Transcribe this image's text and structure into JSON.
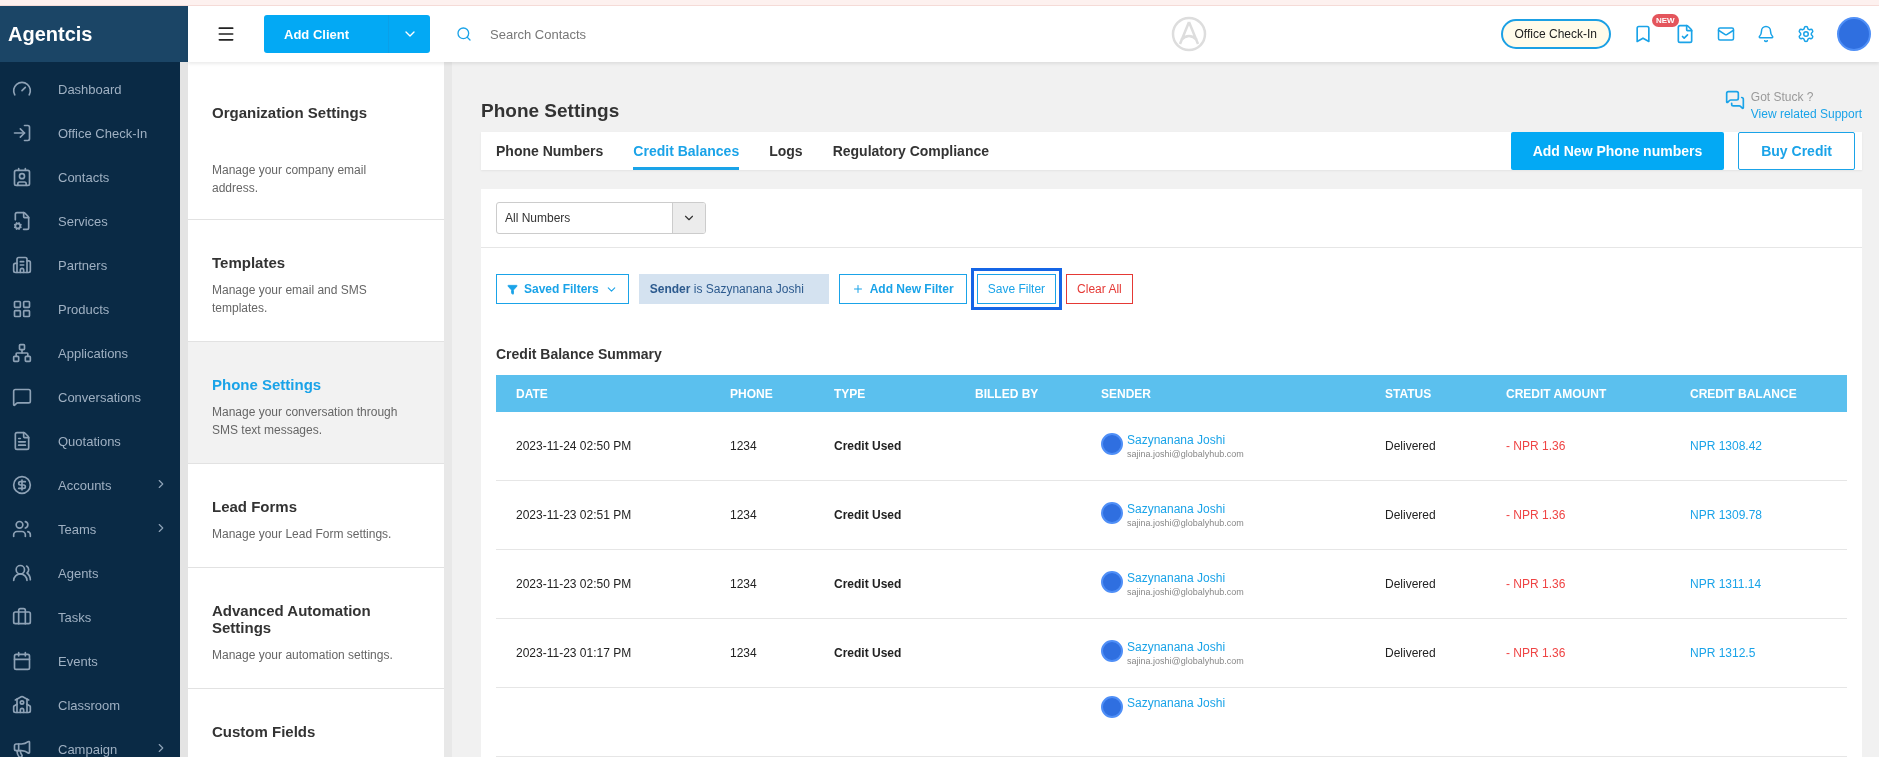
{
  "brand": "Agentcis",
  "nav": [
    {
      "label": "Dashboard",
      "has_submenu": false
    },
    {
      "label": "Office Check-In",
      "has_submenu": false
    },
    {
      "label": "Contacts",
      "has_submenu": false
    },
    {
      "label": "Services",
      "has_submenu": false
    },
    {
      "label": "Partners",
      "has_submenu": false
    },
    {
      "label": "Products",
      "has_submenu": false
    },
    {
      "label": "Applications",
      "has_submenu": false
    },
    {
      "label": "Conversations",
      "has_submenu": false
    },
    {
      "label": "Quotations",
      "has_submenu": false
    },
    {
      "label": "Accounts",
      "has_submenu": true
    },
    {
      "label": "Teams",
      "has_submenu": true
    },
    {
      "label": "Agents",
      "has_submenu": false
    },
    {
      "label": "Tasks",
      "has_submenu": false
    },
    {
      "label": "Events",
      "has_submenu": false
    },
    {
      "label": "Classroom",
      "has_submenu": false
    },
    {
      "label": "Campaign",
      "has_submenu": true
    }
  ],
  "topbar": {
    "add_client": "Add Client",
    "search": {
      "placeholder": "Search Contacts"
    },
    "check_in": "Office Check-In",
    "badge": "NEW"
  },
  "settings": [
    {
      "title": "Organization Settings",
      "description": "Manage your company email address.",
      "selected": false
    },
    {
      "title": "Templates",
      "description": "Manage your email and SMS templates.",
      "selected": false
    },
    {
      "title": "Phone Settings",
      "description": "Manage your conversation through SMS text messages.",
      "selected": true
    },
    {
      "title": "Lead Forms",
      "description": "Manage your Lead Form settings.",
      "selected": false
    },
    {
      "title": "Advanced Automation Settings",
      "description": "Manage your automation settings.",
      "selected": false
    },
    {
      "title": "Custom Fields",
      "selected": false
    }
  ],
  "page_title": "Phone Settings",
  "help": {
    "question": "Got Stuck ?",
    "link": "View related Support"
  },
  "tabs": [
    {
      "label": "Phone Numbers",
      "selected": false
    },
    {
      "label": "Credit Balances",
      "selected": true
    },
    {
      "label": "Logs",
      "selected": false
    },
    {
      "label": "Regulatory Compliance",
      "selected": false
    }
  ],
  "actions": {
    "add": "Add New Phone numbers",
    "buy": "Buy Credit"
  },
  "number_select": {
    "value": "All Numbers"
  },
  "filters": {
    "saved": "Saved Filters",
    "chip": "**Sender** is Sazynanana Joshi",
    "add": "Add New Filter",
    "save": "Save Filter",
    "save_focused": true,
    "clear": "Clear All"
  },
  "table": {
    "title": "Credit Balance Summary",
    "columns": [
      "DATE",
      "PHONE",
      "TYPE",
      "BILLED BY",
      "SENDER",
      "STATUS",
      "CREDIT AMOUNT",
      "CREDIT BALANCE"
    ],
    "rows": [
      {
        "date": "2023-11-24 02:50 PM",
        "phone": "1234",
        "type": "Credit Used",
        "sender": "Sazynanana Joshi",
        "email": "sajina.joshi@globalyhub.com",
        "status": "Delivered",
        "amount": "- NPR 1.36",
        "balance": "NPR 1308.42"
      },
      {
        "date": "2023-11-23 02:51 PM",
        "phone": "1234",
        "type": "Credit Used",
        "sender": "Sazynanana Joshi",
        "email": "sajina.joshi@globalyhub.com",
        "status": "Delivered",
        "amount": "- NPR 1.36",
        "balance": "NPR 1309.78"
      },
      {
        "date": "2023-11-23 02:50 PM",
        "phone": "1234",
        "type": "Credit Used",
        "sender": "Sazynanana Joshi",
        "email": "sajina.joshi@globalyhub.com",
        "status": "Delivered",
        "amount": "- NPR 1.36",
        "balance": "NPR 1311.14"
      },
      {
        "date": "2023-11-23 01:17 PM",
        "phone": "1234",
        "type": "Credit Used",
        "sender": "Sazynanana Joshi",
        "email": "sajina.joshi@globalyhub.com",
        "status": "Delivered",
        "amount": "- NPR 1.36",
        "balance": "NPR 1312.5"
      },
      {
        "sender": "Sazynanana Joshi"
      }
    ]
  }
}
